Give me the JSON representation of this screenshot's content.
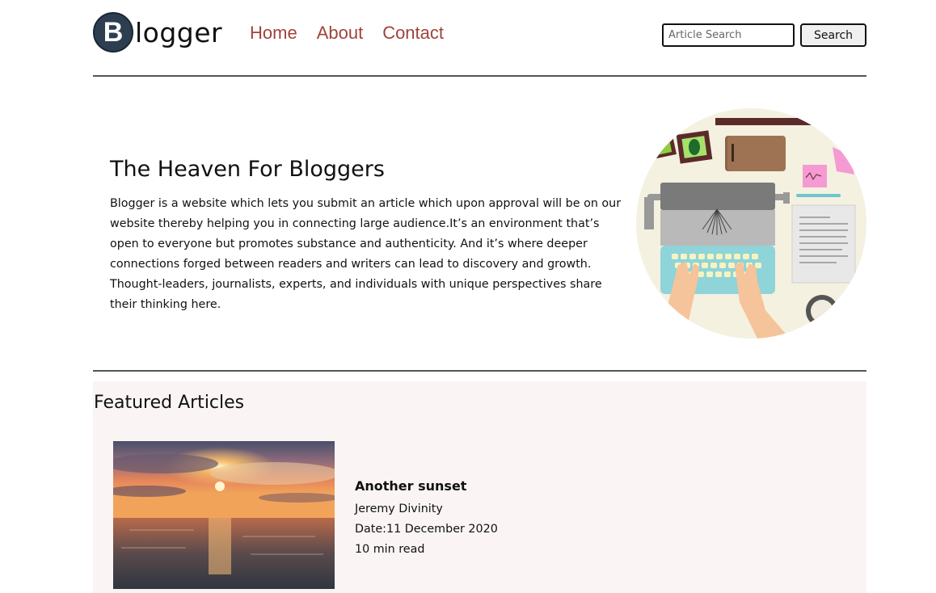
{
  "header": {
    "logo_initial": "B",
    "logo_text": "logger",
    "nav": [
      {
        "label": "Home"
      },
      {
        "label": "About"
      },
      {
        "label": "Contact"
      }
    ],
    "search": {
      "placeholder": "Article Search",
      "button_label": "Search"
    }
  },
  "hero": {
    "title": "The Heaven For Bloggers",
    "text": "Blogger is a website which lets you submit an article which upon approval will be on our website thereby helping you in connecting large audience.It’s an environment that’s open to everyone but promotes substance and authenticity. And it’s where deeper connections forged between readers and writers can lead to discovery and growth. Thought-leaders, journalists, experts, and individuals with unique perspectives share their thinking here.",
    "illustration_icon": "typewriter-desk-illustration"
  },
  "featured": {
    "title": "Featured Articles",
    "articles": [
      {
        "title": "Another sunset",
        "author": "Jeremy Divinity",
        "date": "Date:11 December 2020",
        "read_time": "10 min read",
        "image_icon": "sunset-photo"
      }
    ]
  },
  "colors": {
    "nav_link": "#a0433c",
    "logo_badge": "#2c3e50",
    "featured_bg": "#faf5f4",
    "divider": "#555555"
  }
}
